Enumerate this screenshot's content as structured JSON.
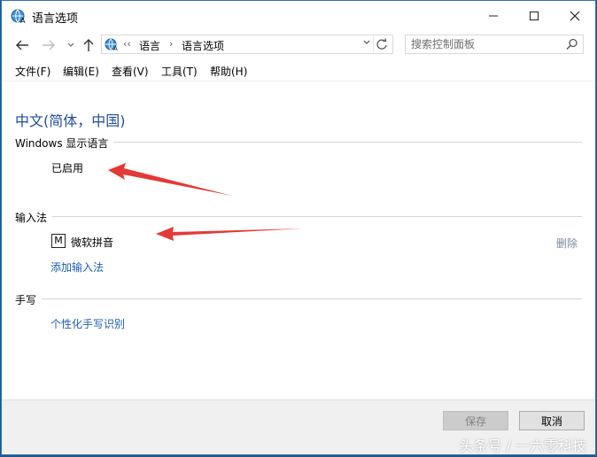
{
  "window": {
    "title": "语言选项",
    "accent_color": "#2b73b8"
  },
  "address": {
    "overflow": "‹‹",
    "crumbs": [
      "语言",
      "语言选项"
    ],
    "separator": "›",
    "dropdown_icon": "chevron-down-icon",
    "refresh_icon": "refresh-icon"
  },
  "search": {
    "placeholder": "搜索控制面板"
  },
  "menu": {
    "items": [
      "文件(F)",
      "编辑(E)",
      "查看(V)",
      "工具(T)",
      "帮助(H)"
    ]
  },
  "content": {
    "language_name": "中文(简体，中国)",
    "display_section": {
      "label": "Windows 显示语言",
      "status": "已启用"
    },
    "ime_section": {
      "label": "输入法",
      "ime_icon_text": "M",
      "ime_name": "微软拼音",
      "remove_label": "删除",
      "add_link": "添加输入法"
    },
    "handwriting_section": {
      "label": "手写",
      "link": "个性化手写识别"
    }
  },
  "footer": {
    "save_label": "保存",
    "cancel_label": "取消"
  },
  "watermark": "头条号 / 一六零科技",
  "annotation_color": "#e53935"
}
